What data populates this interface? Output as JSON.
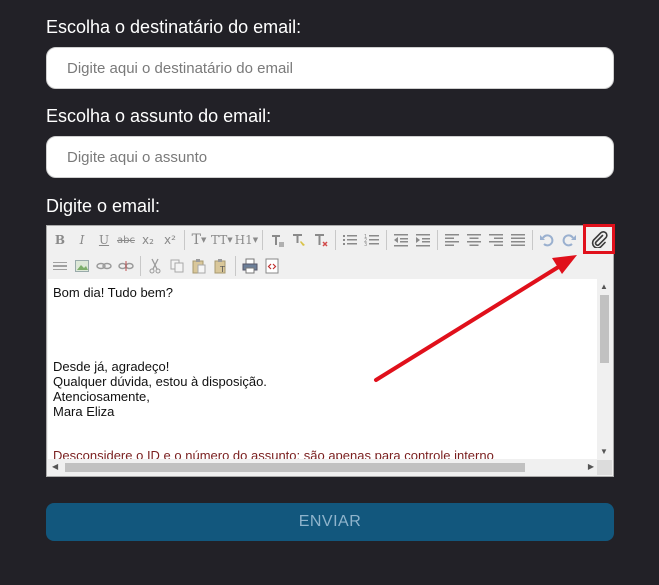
{
  "form": {
    "recipient_label": "Escolha o destinatário do email:",
    "recipient_placeholder": "Digite aqui o destinatário do email",
    "subject_label": "Escolha o assunto do email:",
    "subject_placeholder": "Digite aqui o assunto",
    "body_label": "Digite o email:",
    "send_label": "ENVIAR"
  },
  "editor": {
    "toolbar_row1": [
      "B",
      "I",
      "U",
      "abc",
      "x₂",
      "x²",
      "T",
      "TT",
      "H1"
    ],
    "content_lines": [
      "Bom dia! Tudo bem?",
      "Desde já, agradeço!",
      "Qualquer dúvida, estou à disposição.",
      "Atenciosamente,",
      "Mara Eliza",
      "Desconsidere o ID e o número do assunto; são apenas para controle interno"
    ]
  },
  "annotation": {
    "highlight_color": "#e0101b",
    "highlighted_icon": "paperclip-icon"
  },
  "colors": {
    "background": "#222127",
    "send_button": "#12577d",
    "send_text": "#8fb4cc"
  }
}
